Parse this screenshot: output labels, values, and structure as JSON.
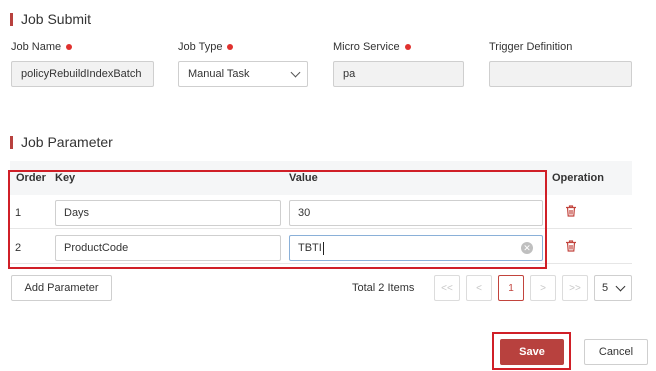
{
  "job_submit": {
    "title": "Job Submit",
    "fields": {
      "job_name": {
        "label": "Job Name",
        "required": true,
        "value": "policyRebuildIndexBatch"
      },
      "job_type": {
        "label": "Job Type",
        "required": true,
        "value": "Manual Task"
      },
      "micro_service": {
        "label": "Micro Service",
        "required": true,
        "value": "pa"
      },
      "trigger_definition": {
        "label": "Trigger Definition",
        "required": false,
        "value": ""
      }
    }
  },
  "job_parameter": {
    "title": "Job Parameter",
    "columns": {
      "order": "Order",
      "key": "Key",
      "value": "Value",
      "operation": "Operation"
    },
    "rows": [
      {
        "order": "1",
        "key": "Days",
        "value": "30"
      },
      {
        "order": "2",
        "key": "ProductCode",
        "value": "TBTI"
      }
    ],
    "add_button": "Add Parameter"
  },
  "pagination": {
    "total_label": "Total 2 Items",
    "first": "<<",
    "prev": "<",
    "current_page": "1",
    "next": ">",
    "last": ">>",
    "page_size": "5"
  },
  "actions": {
    "save": "Save",
    "cancel": "Cancel"
  },
  "colors": {
    "accent": "#b8413e",
    "highlight": "#d01f27",
    "required_dot": "#e0312e"
  },
  "icons": {
    "delete": "trash-icon",
    "clear": "clear-icon",
    "dropdown": "chevron-down-icon"
  }
}
